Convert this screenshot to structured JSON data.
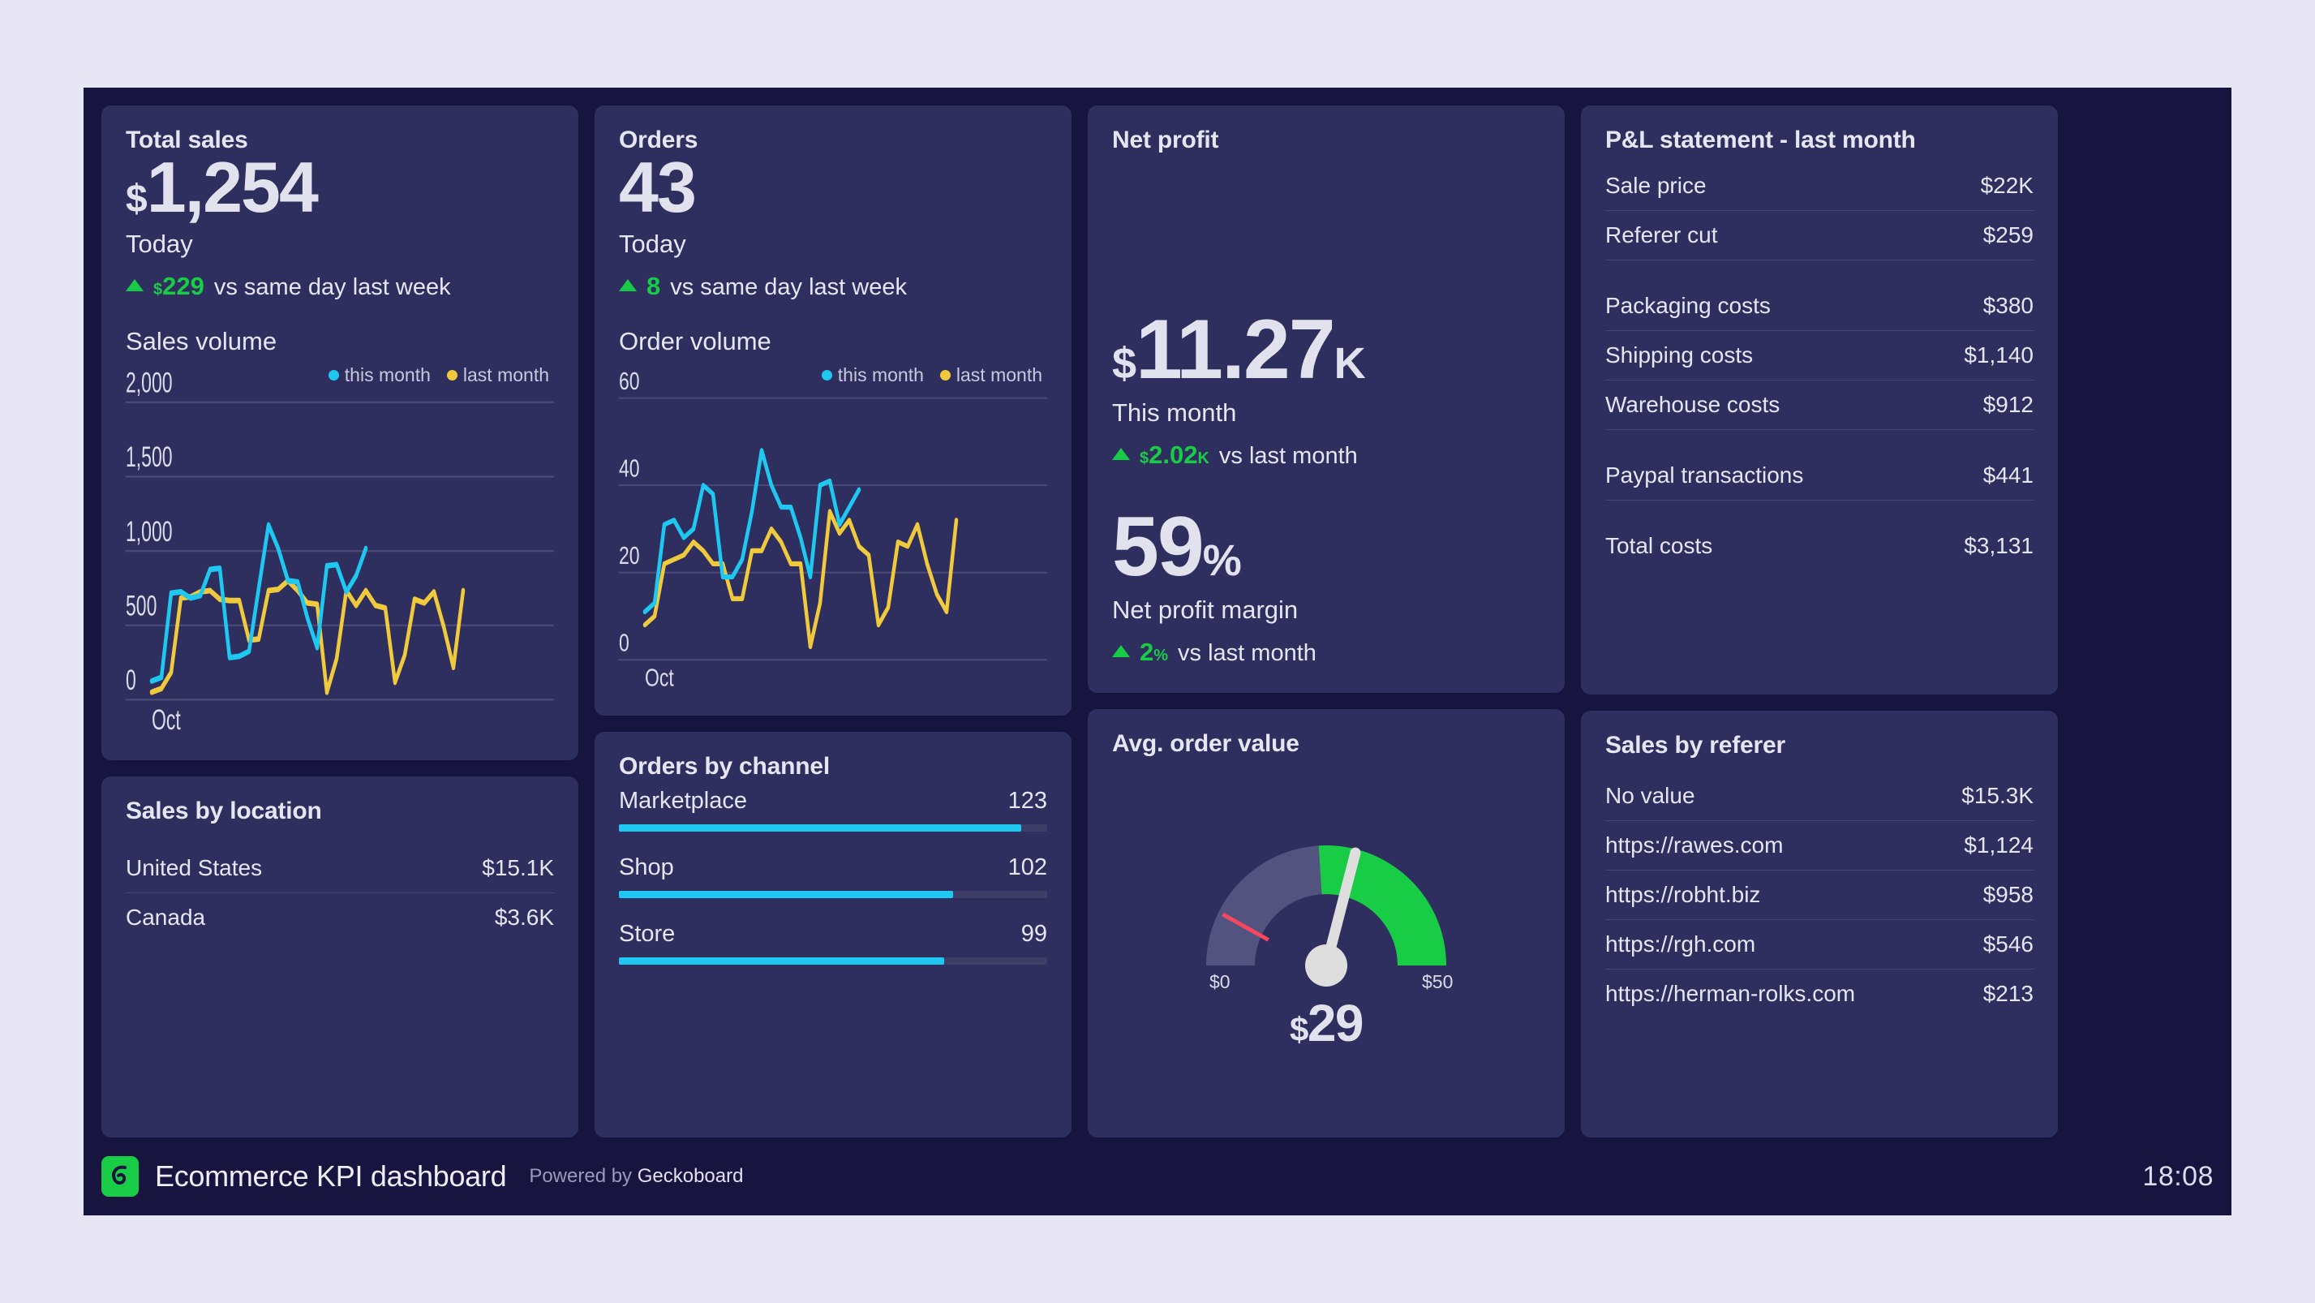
{
  "footer": {
    "title": "Ecommerce KPI dashboard",
    "powered_prefix": "Powered by ",
    "powered_brand": "Geckoboard",
    "clock": "18:08",
    "logo_icon": "geckoboard-logo-icon"
  },
  "colors": {
    "page_background": "#e8e6f5",
    "dashboard_background": "#171440",
    "panel_background": "#2e2f5e",
    "green": "#18cc45",
    "cyan": "#1ec8f0",
    "gold": "#f0c93c",
    "red": "#f5485f",
    "text": "#e6e6f2"
  },
  "total_sales": {
    "title": "Total sales",
    "value_symbol": "$",
    "value": "1,254",
    "label": "Today",
    "delta_symbol": "$",
    "delta_value": "229",
    "delta_text": "vs same day last week",
    "delta_direction": "up"
  },
  "sales_volume": {
    "title": "Sales volume",
    "legend": [
      {
        "label": "this month",
        "color": "#1ec8f0"
      },
      {
        "label": "last month",
        "color": "#f0c93c"
      }
    ]
  },
  "sales_by_location": {
    "title": "Sales by location",
    "rows": [
      {
        "label": "United States",
        "value": "$15.1K"
      },
      {
        "label": "Canada",
        "value": "$3.6K"
      }
    ]
  },
  "orders": {
    "title": "Orders",
    "value": "43",
    "label": "Today",
    "delta_value": "8",
    "delta_text": "vs same day last week",
    "delta_direction": "up"
  },
  "order_volume": {
    "title": "Order volume",
    "legend": [
      {
        "label": "this month",
        "color": "#1ec8f0"
      },
      {
        "label": "last month",
        "color": "#f0c93c"
      }
    ]
  },
  "orders_by_channel": {
    "title": "Orders by channel",
    "rows": [
      {
        "label": "Marketplace",
        "value": "123",
        "pct": 94
      },
      {
        "label": "Shop",
        "value": "102",
        "pct": 78
      },
      {
        "label": "Store",
        "value": "99",
        "pct": 76
      }
    ]
  },
  "net_profit": {
    "title": "Net profit",
    "value_symbol": "$",
    "value": "11.27",
    "value_suffix": "K",
    "label": "This month",
    "delta_symbol": "$",
    "delta_value": "2.02",
    "delta_suffix": "K",
    "delta_text": "vs last month",
    "margin_value": "59",
    "margin_suffix": "%",
    "margin_label": "Net profit margin",
    "margin_delta_value": "2",
    "margin_delta_suffix": "%",
    "margin_delta_text": "vs last month"
  },
  "avg_order_value": {
    "title": "Avg. order value",
    "min_label_symbol": "$",
    "min_label": "0",
    "max_label_symbol": "$",
    "max_label": "50",
    "value_symbol": "$",
    "value": "29"
  },
  "pl_statement": {
    "title": "P&L statement - last month",
    "groups": [
      [
        {
          "label": "Sale price",
          "value": "$22K"
        },
        {
          "label": "Referer cut",
          "value": "$259"
        }
      ],
      [
        {
          "label": "Packaging costs",
          "value": "$380"
        },
        {
          "label": "Shipping costs",
          "value": "$1,140"
        },
        {
          "label": "Warehouse costs",
          "value": "$912"
        }
      ],
      [
        {
          "label": "Paypal transactions",
          "value": "$441"
        }
      ],
      [
        {
          "label": "Total costs",
          "value": "$3,131"
        }
      ]
    ]
  },
  "sales_by_referer": {
    "title": "Sales by referer",
    "rows": [
      {
        "label": "No value",
        "value": "$15.3K"
      },
      {
        "label": "https://rawes.com",
        "value": "$1,124"
      },
      {
        "label": "https://robht.biz",
        "value": "$958"
      },
      {
        "label": "https://rgh.com",
        "value": "$546"
      },
      {
        "label": "https://herman-rolks.com",
        "value": "$213"
      }
    ]
  },
  "chart_data": [
    {
      "type": "line",
      "title": "Sales volume",
      "xlabel": "Oct",
      "ylabel": "",
      "ylim": [
        0,
        2000
      ],
      "yticks": [
        0,
        500,
        1000,
        1500,
        2000
      ],
      "ytick_labels": [
        "0",
        "500",
        "1,000",
        "1,500",
        "2,000"
      ],
      "grid": true,
      "legend_position": "top-right",
      "series": [
        {
          "name": "this month",
          "color": "#1ec8f0",
          "values": [
            250,
            300,
            880,
            900,
            820,
            860,
            1090,
            1100,
            560,
            570,
            620,
            1000,
            1350,
            1180,
            930,
            920,
            700,
            540,
            1100,
            1110,
            900,
            1000,
            1180,
            null,
            null,
            null,
            null,
            null,
            null,
            null,
            null
          ]
        },
        {
          "name": "last month",
          "color": "#f0c93c",
          "values": [
            180,
            200,
            740,
            750,
            790,
            800,
            700,
            690,
            690,
            400,
            410,
            800,
            810,
            890,
            810,
            700,
            690,
            200,
            430,
            960,
            800,
            930,
            800,
            780,
            230,
            400,
            830,
            800,
            900,
            650,
            440,
            240,
            930
          ]
        }
      ]
    },
    {
      "type": "line",
      "title": "Order volume",
      "xlabel": "Oct",
      "ylabel": "",
      "ylim": [
        0,
        60
      ],
      "yticks": [
        0,
        20,
        40,
        60
      ],
      "ytick_labels": [
        "0",
        "20",
        "40",
        "60"
      ],
      "grid": true,
      "legend_position": "top-right",
      "series": [
        {
          "name": "this month",
          "color": "#1ec8f0",
          "values": [
            11,
            13,
            31,
            32,
            28,
            30,
            40,
            38,
            19,
            19,
            23,
            34,
            48,
            40,
            35,
            35,
            28,
            19,
            40,
            41,
            31,
            35,
            39,
            null,
            null,
            null,
            null,
            null,
            null,
            null,
            null
          ]
        },
        {
          "name": "last month",
          "color": "#f0c93c",
          "values": [
            8,
            10,
            22,
            23,
            24,
            27,
            25,
            22,
            22,
            14,
            14,
            25,
            25,
            30,
            27,
            22,
            22,
            3,
            13,
            34,
            29,
            32,
            26,
            24,
            8,
            12,
            27,
            26,
            31,
            22,
            15,
            11,
            34
          ]
        }
      ]
    },
    {
      "type": "bar",
      "title": "Orders by channel",
      "categories": [
        "Marketplace",
        "Shop",
        "Store"
      ],
      "values": [
        123,
        102,
        99
      ],
      "orientation": "horizontal",
      "color": "#1ec8f0"
    },
    {
      "type": "gauge",
      "title": "Avg. order value",
      "value": 29,
      "min": 0,
      "max": 50,
      "target": 10,
      "band_start": 24,
      "band_color": "#18cc45",
      "track_color": "#53537f"
    }
  ]
}
